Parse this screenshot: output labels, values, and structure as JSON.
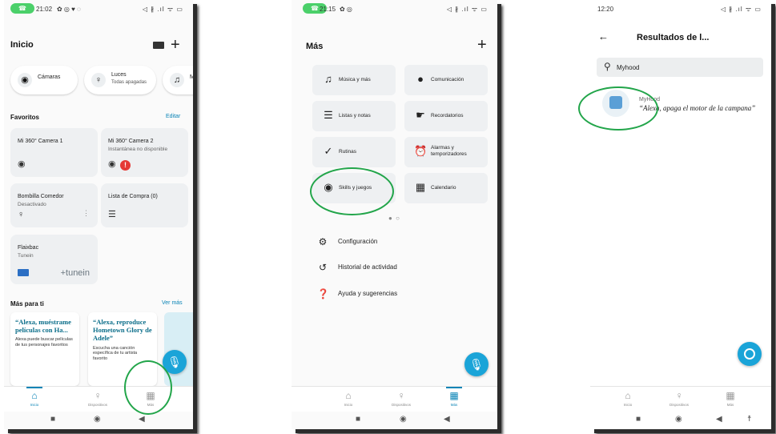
{
  "phone1": {
    "status_time": "21:02",
    "status_icons": "◁ ∦ .ıl ᯤ ▭",
    "header_title": "Inicio",
    "keyboard_icon": "keyboard-icon",
    "chips": [
      {
        "label": "Cámaras",
        "sub": "",
        "icon": "camera-icon"
      },
      {
        "label": "Luces",
        "sub": "Todas apagadas",
        "icon": "bulb-icon"
      },
      {
        "label": "Mú",
        "sub": "",
        "icon": "music-icon"
      }
    ],
    "favorites_title": "Favoritos",
    "favorites_edit": "Editar",
    "cards": [
      {
        "title": "Mi 360° Camera 1",
        "sub": ""
      },
      {
        "title": "Mi 360° Camera 2",
        "sub": "Instantánea no disponible"
      },
      {
        "title": "Bombilla Comedor",
        "sub": "Desactivado"
      },
      {
        "title": "Lista de Compra (0)",
        "sub": ""
      },
      {
        "title": "Flaixbac",
        "sub": "Tunein"
      }
    ],
    "tunein_label": "+tunein",
    "more_title": "Más para ti",
    "more_link": "Ver más",
    "promos": [
      {
        "quote": "“Alexa, muéstrame películas con Ha...",
        "desc": "Alexa puede buscar películas de tus personajes favoritos"
      },
      {
        "quote": "“Alexa, reproduce Hometown Glory de Adele”",
        "desc": "Escucha una canción específica de tu artista favorito"
      }
    ],
    "tabs": [
      "Inicio",
      "Dispositivos",
      "Más"
    ]
  },
  "phone2": {
    "status_time": "21:15",
    "status_icons": "◁ ∦ .ıl ᯤ ▭",
    "header_title": "Más",
    "tiles": [
      {
        "label": "Música y más",
        "icon": "music-icon"
      },
      {
        "label": "Comunicación",
        "icon": "chat-icon"
      },
      {
        "label": "Listas y notas",
        "icon": "list-icon"
      },
      {
        "label": "Recordatorios",
        "icon": "reminder-icon"
      },
      {
        "label": "Rutinas",
        "icon": "routine-icon"
      },
      {
        "label": "Alarmas y temporizadores",
        "icon": "alarm-icon"
      },
      {
        "label": "Skills y juegos",
        "icon": "skills-icon"
      },
      {
        "label": "Calendario",
        "icon": "calendar-icon"
      }
    ],
    "menu": [
      {
        "label": "Configuración",
        "icon": "gear-icon"
      },
      {
        "label": "Historial de actividad",
        "icon": "history-icon"
      },
      {
        "label": "Ayuda y sugerencias",
        "icon": "help-icon"
      }
    ],
    "tabs": [
      "Inicio",
      "Dispositivos",
      "Más"
    ]
  },
  "phone3": {
    "status_time": "12:20",
    "status_icons": "◁ ∦ .ıl ᯤ ▭",
    "header_title": "Resultados de l...",
    "search_value": "Myhood",
    "result_name": "MyHood",
    "result_desc": "“Alexa, apaga el motor de la campana”",
    "tabs": [
      "Inicio",
      "Dispositivos",
      "Más"
    ]
  },
  "colors": {
    "accent": "#0a84b6",
    "highlight_ring": "#22a54a",
    "call_pill": "#4bd06a",
    "alert": "#e53935"
  }
}
